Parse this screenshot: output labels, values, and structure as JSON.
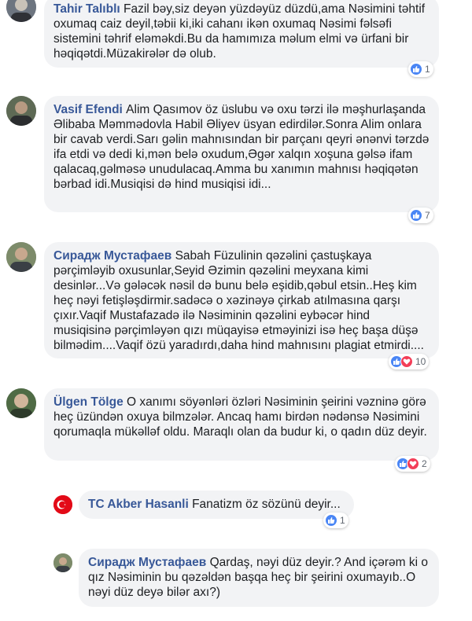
{
  "comments": [
    {
      "author": "Tahir Talıblı",
      "text": "Fazil bəy,siz deyən yüzdəyüz düzdü,ama Nəsimini təhtif oxumaq caiz deyil,təbii ki,iki cahanı ikən oxumaq Nəsimi fəlsəfi sistemini təhrif eləməkdi.Bu da hamımıza məlum elmi və ürfani bir həqiqətdi.Müzakirələr də olub.",
      "reaction_count": "1",
      "reactions": [
        "like"
      ]
    },
    {
      "author": "Vasif Efendi",
      "text": "Alim Qasımov öz üslubu və oxu tərzi ilə məşhurlaşanda Əlibaba Məmmədovla Habil Əliyev üsyan edirdilər.Sonra Alim onlara bir cavab verdi.Sarı gəlin mahnısından bir parçanı qeyri ənənvi tərzdə ifa etdi və dedi ki,mən belə oxudum,Əgər xalqın xoşuna gəlsə ifam qalacaq,gəlməsə unudulacaq.Amma bu xanımın mahnısı həqiqətən bərbad idi.Musiqisi də hind musiqisi idi...",
      "reaction_count": "7",
      "reactions": [
        "like"
      ]
    },
    {
      "author": "Сирадж Мустафаев",
      "text": "Sabah Füzulinin qəzəlini çastuşkaya pərçimləyib oxusunlar,Seyid Əzimin qəzəlini meyxana kimi desinlər...Və gələcək nəsil də bunu belə eşidib,qəbul etsin..Heş kim heç nəyi fetişləşdirmir.sadəcə o xəzinəyə çirkab atılmasına qarşı çıxır.Vaqif Mustafazadə ilə Nəsiminin qəzəlini eybəcər hind musiqisinə pərçimləyən qızı müqayisə etməyinizi isə heç başa düşə bilmədim....Vaqif özü yaradırdı,daha hind mahnısını plagiat etmirdi....",
      "reaction_count": "10",
      "reactions": [
        "like",
        "love"
      ]
    },
    {
      "author": "Ülgen Tölge",
      "text": "O xanımı söyənləri özləri Nəsiminin şeirini vəzninə görə heç üzündən oxuya bilmzələr. Ancaq hamı birdən nədənsə Nəsimini qorumaqla mükəlləf oldu. Maraqlı olan da budur ki, o qadın düz deyir.",
      "reaction_count": "2",
      "reactions": [
        "like",
        "love"
      ]
    },
    {
      "author": "TC Akber Hasanli",
      "text": "Fanatizm öz sözünü deyir...",
      "reaction_count": "1",
      "reactions": [
        "like"
      ]
    },
    {
      "author": "Сирадж Мустафаев",
      "text": "Qardaş, nəyi düz deyir.? And içərəm ki o qız Nəsiminin bu qəzəldən başqa heç bir şeirini oxumayıb..O nəyi düz deyə bilər axı?)",
      "reaction_count": "",
      "reactions": []
    }
  ],
  "colors": {
    "author": "#385898",
    "bubble": "#f2f3f5",
    "like": "#4a86f5",
    "love": "#f33e58"
  }
}
